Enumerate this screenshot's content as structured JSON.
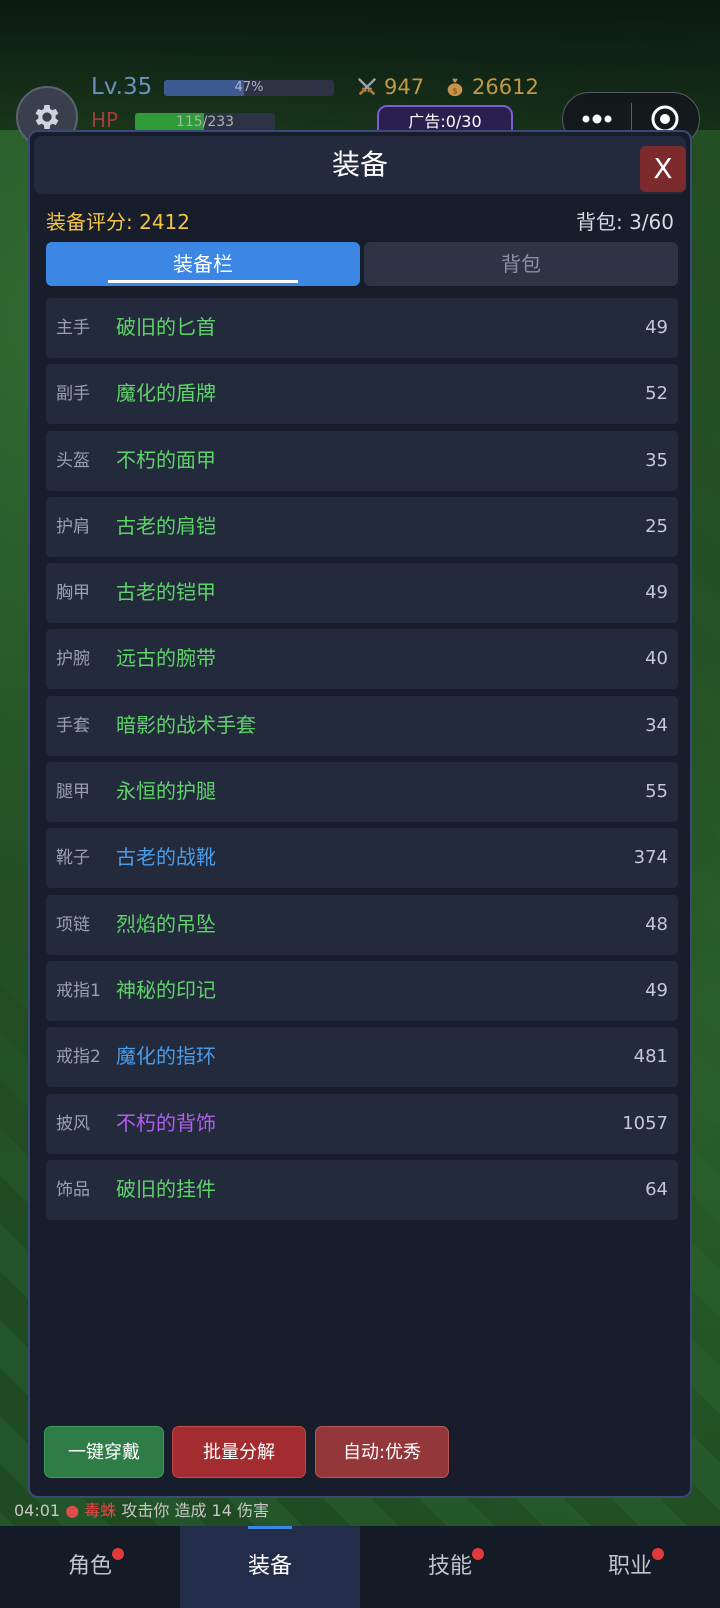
{
  "hud": {
    "level": "Lv.35",
    "xp_percent": "47%",
    "xp_fraction": 0.47,
    "hp_label": "HP",
    "hp_text": "115/233",
    "hp_fraction": 0.49,
    "attack": "947",
    "gold": "26612",
    "ad_counter": "广告:0/30"
  },
  "modal": {
    "title": "装备",
    "close_label": "X",
    "score_label": "装备评分: ",
    "score_value": "2412",
    "bag_label": "背包: 3/60",
    "tabs": [
      {
        "label": "装备栏",
        "active": true
      },
      {
        "label": "背包",
        "active": false
      }
    ],
    "slots": [
      {
        "slot": "主手",
        "item": "破旧的匕首",
        "score": "49",
        "color": "#5fd36a"
      },
      {
        "slot": "副手",
        "item": "魔化的盾牌",
        "score": "52",
        "color": "#5fd36a"
      },
      {
        "slot": "头盔",
        "item": "不朽的面甲",
        "score": "35",
        "color": "#5fd36a"
      },
      {
        "slot": "护肩",
        "item": "古老的肩铠",
        "score": "25",
        "color": "#5fd36a"
      },
      {
        "slot": "胸甲",
        "item": "古老的铠甲",
        "score": "49",
        "color": "#5fd36a"
      },
      {
        "slot": "护腕",
        "item": "远古的腕带",
        "score": "40",
        "color": "#5fd36a"
      },
      {
        "slot": "手套",
        "item": "暗影的战术手套",
        "score": "34",
        "color": "#5fd36a"
      },
      {
        "slot": "腿甲",
        "item": "永恒的护腿",
        "score": "55",
        "color": "#5fd36a"
      },
      {
        "slot": "靴子",
        "item": "古老的战靴",
        "score": "374",
        "color": "#4a9be8"
      },
      {
        "slot": "项链",
        "item": "烈焰的吊坠",
        "score": "48",
        "color": "#5fd36a"
      },
      {
        "slot": "戒指1",
        "item": "神秘的印记",
        "score": "49",
        "color": "#5fd36a"
      },
      {
        "slot": "戒指2",
        "item": "魔化的指环",
        "score": "481",
        "color": "#4a9be8"
      },
      {
        "slot": "披风",
        "item": "不朽的背饰",
        "score": "1057",
        "color": "#b45cf0"
      },
      {
        "slot": "饰品",
        "item": "破旧的挂件",
        "score": "64",
        "color": "#5fd36a"
      }
    ],
    "actions": {
      "wear_all": "一键穿戴",
      "batch_salvage": "批量分解",
      "auto_quality": "自动:优秀"
    }
  },
  "log": {
    "time": "04:01",
    "monster": "毒蛛",
    "text": " 攻击你 造成 14 伤害"
  },
  "nav": [
    {
      "label": "角色",
      "active": false,
      "dot": true
    },
    {
      "label": "装备",
      "active": true,
      "dot": false
    },
    {
      "label": "技能",
      "active": false,
      "dot": true
    },
    {
      "label": "职业",
      "active": false,
      "dot": true
    }
  ]
}
